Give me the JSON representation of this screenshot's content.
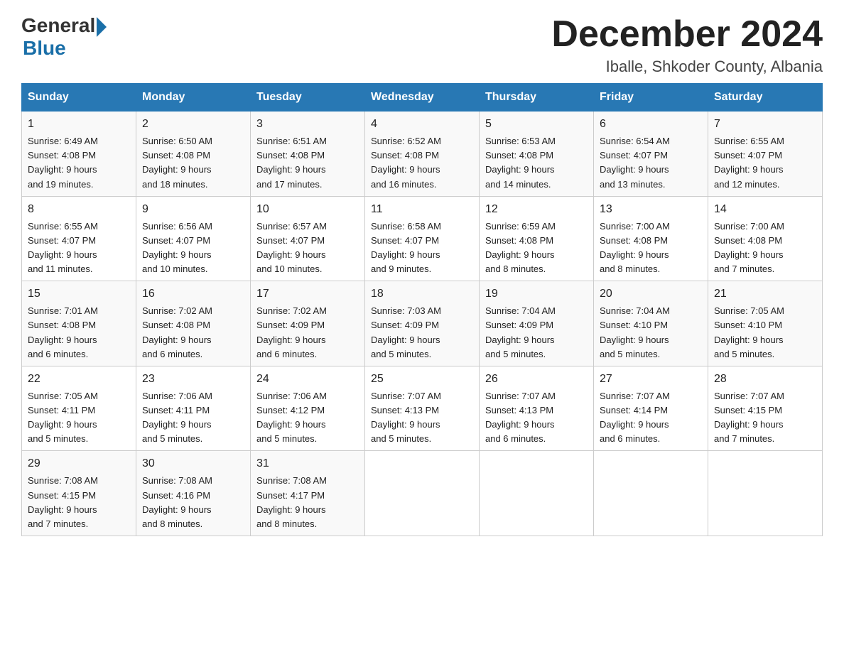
{
  "header": {
    "logo_general": "General",
    "logo_blue": "Blue",
    "month_title": "December 2024",
    "location": "Iballe, Shkoder County, Albania"
  },
  "days_of_week": [
    "Sunday",
    "Monday",
    "Tuesday",
    "Wednesday",
    "Thursday",
    "Friday",
    "Saturday"
  ],
  "weeks": [
    [
      {
        "num": "1",
        "info": "Sunrise: 6:49 AM\nSunset: 4:08 PM\nDaylight: 9 hours\nand 19 minutes."
      },
      {
        "num": "2",
        "info": "Sunrise: 6:50 AM\nSunset: 4:08 PM\nDaylight: 9 hours\nand 18 minutes."
      },
      {
        "num": "3",
        "info": "Sunrise: 6:51 AM\nSunset: 4:08 PM\nDaylight: 9 hours\nand 17 minutes."
      },
      {
        "num": "4",
        "info": "Sunrise: 6:52 AM\nSunset: 4:08 PM\nDaylight: 9 hours\nand 16 minutes."
      },
      {
        "num": "5",
        "info": "Sunrise: 6:53 AM\nSunset: 4:08 PM\nDaylight: 9 hours\nand 14 minutes."
      },
      {
        "num": "6",
        "info": "Sunrise: 6:54 AM\nSunset: 4:07 PM\nDaylight: 9 hours\nand 13 minutes."
      },
      {
        "num": "7",
        "info": "Sunrise: 6:55 AM\nSunset: 4:07 PM\nDaylight: 9 hours\nand 12 minutes."
      }
    ],
    [
      {
        "num": "8",
        "info": "Sunrise: 6:55 AM\nSunset: 4:07 PM\nDaylight: 9 hours\nand 11 minutes."
      },
      {
        "num": "9",
        "info": "Sunrise: 6:56 AM\nSunset: 4:07 PM\nDaylight: 9 hours\nand 10 minutes."
      },
      {
        "num": "10",
        "info": "Sunrise: 6:57 AM\nSunset: 4:07 PM\nDaylight: 9 hours\nand 10 minutes."
      },
      {
        "num": "11",
        "info": "Sunrise: 6:58 AM\nSunset: 4:07 PM\nDaylight: 9 hours\nand 9 minutes."
      },
      {
        "num": "12",
        "info": "Sunrise: 6:59 AM\nSunset: 4:08 PM\nDaylight: 9 hours\nand 8 minutes."
      },
      {
        "num": "13",
        "info": "Sunrise: 7:00 AM\nSunset: 4:08 PM\nDaylight: 9 hours\nand 8 minutes."
      },
      {
        "num": "14",
        "info": "Sunrise: 7:00 AM\nSunset: 4:08 PM\nDaylight: 9 hours\nand 7 minutes."
      }
    ],
    [
      {
        "num": "15",
        "info": "Sunrise: 7:01 AM\nSunset: 4:08 PM\nDaylight: 9 hours\nand 6 minutes."
      },
      {
        "num": "16",
        "info": "Sunrise: 7:02 AM\nSunset: 4:08 PM\nDaylight: 9 hours\nand 6 minutes."
      },
      {
        "num": "17",
        "info": "Sunrise: 7:02 AM\nSunset: 4:09 PM\nDaylight: 9 hours\nand 6 minutes."
      },
      {
        "num": "18",
        "info": "Sunrise: 7:03 AM\nSunset: 4:09 PM\nDaylight: 9 hours\nand 5 minutes."
      },
      {
        "num": "19",
        "info": "Sunrise: 7:04 AM\nSunset: 4:09 PM\nDaylight: 9 hours\nand 5 minutes."
      },
      {
        "num": "20",
        "info": "Sunrise: 7:04 AM\nSunset: 4:10 PM\nDaylight: 9 hours\nand 5 minutes."
      },
      {
        "num": "21",
        "info": "Sunrise: 7:05 AM\nSunset: 4:10 PM\nDaylight: 9 hours\nand 5 minutes."
      }
    ],
    [
      {
        "num": "22",
        "info": "Sunrise: 7:05 AM\nSunset: 4:11 PM\nDaylight: 9 hours\nand 5 minutes."
      },
      {
        "num": "23",
        "info": "Sunrise: 7:06 AM\nSunset: 4:11 PM\nDaylight: 9 hours\nand 5 minutes."
      },
      {
        "num": "24",
        "info": "Sunrise: 7:06 AM\nSunset: 4:12 PM\nDaylight: 9 hours\nand 5 minutes."
      },
      {
        "num": "25",
        "info": "Sunrise: 7:07 AM\nSunset: 4:13 PM\nDaylight: 9 hours\nand 5 minutes."
      },
      {
        "num": "26",
        "info": "Sunrise: 7:07 AM\nSunset: 4:13 PM\nDaylight: 9 hours\nand 6 minutes."
      },
      {
        "num": "27",
        "info": "Sunrise: 7:07 AM\nSunset: 4:14 PM\nDaylight: 9 hours\nand 6 minutes."
      },
      {
        "num": "28",
        "info": "Sunrise: 7:07 AM\nSunset: 4:15 PM\nDaylight: 9 hours\nand 7 minutes."
      }
    ],
    [
      {
        "num": "29",
        "info": "Sunrise: 7:08 AM\nSunset: 4:15 PM\nDaylight: 9 hours\nand 7 minutes."
      },
      {
        "num": "30",
        "info": "Sunrise: 7:08 AM\nSunset: 4:16 PM\nDaylight: 9 hours\nand 8 minutes."
      },
      {
        "num": "31",
        "info": "Sunrise: 7:08 AM\nSunset: 4:17 PM\nDaylight: 9 hours\nand 8 minutes."
      },
      {
        "num": "",
        "info": ""
      },
      {
        "num": "",
        "info": ""
      },
      {
        "num": "",
        "info": ""
      },
      {
        "num": "",
        "info": ""
      }
    ]
  ]
}
